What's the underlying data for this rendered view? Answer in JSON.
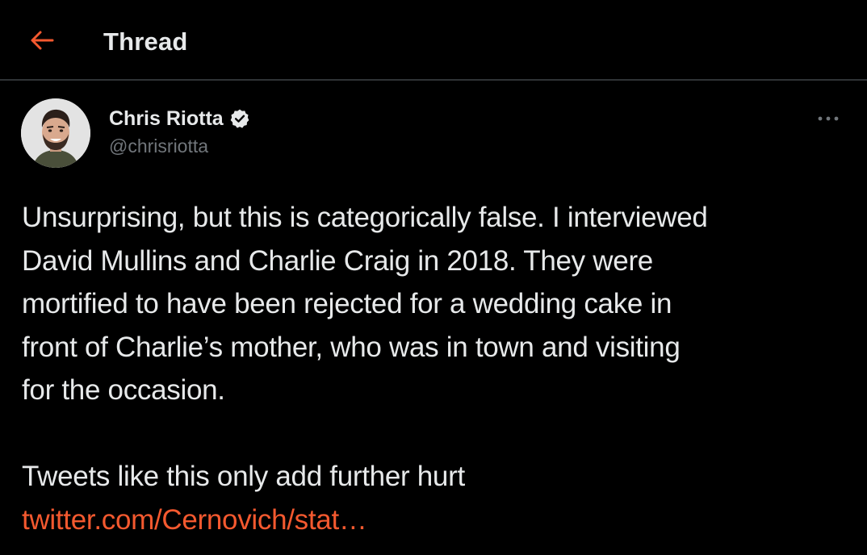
{
  "header": {
    "back_icon": "arrow-left-icon",
    "title": "Thread"
  },
  "tweet": {
    "author": {
      "name": "Chris Riotta",
      "handle": "@chrisriotta",
      "verified_icon": "verified-badge-icon",
      "avatar_icon": "avatar-photo"
    },
    "more_icon": "more-horizontal-icon",
    "text_lines": [
      "Unsurprising, but this is categorically false. I interviewed",
      "David Mullins and Charlie Craig in 2018. They were",
      "mortified to have been rejected for a wedding cake in",
      "front of Charlie’s mother, who was in town and visiting",
      "for the occasion."
    ],
    "text_line_2": "Tweets like this only add further hurt",
    "link": "twitter.com/Cernovich/stat…"
  },
  "colors": {
    "background": "#000000",
    "accent": "#f4592f",
    "text_primary": "#e7e9ea",
    "text_secondary": "#71767b",
    "divider": "#2f3336"
  }
}
